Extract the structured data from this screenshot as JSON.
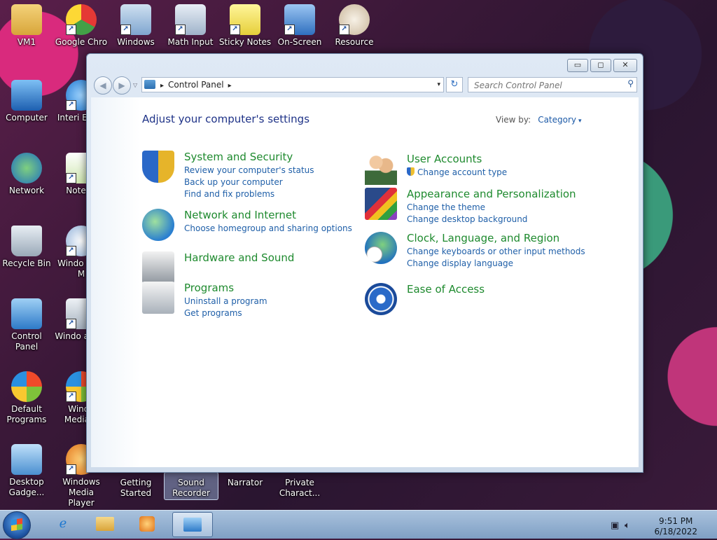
{
  "desktop": {
    "icons": [
      {
        "label": "VM1"
      },
      {
        "label": "Google Chro"
      },
      {
        "label": "Windows"
      },
      {
        "label": "Math Input"
      },
      {
        "label": "Sticky Notes"
      },
      {
        "label": "On-Screen"
      },
      {
        "label": "Resource"
      },
      {
        "label": "Computer"
      },
      {
        "label": "Interi Explo"
      },
      {
        "label": "Network"
      },
      {
        "label": "Notepa"
      },
      {
        "label": "Recycle Bin"
      },
      {
        "label": "Windo DVD M"
      },
      {
        "label": "Control Panel"
      },
      {
        "label": "Windo and S"
      },
      {
        "label": "Default Programs"
      },
      {
        "label": "Windo Media C"
      },
      {
        "label": "Desktop Gadge..."
      },
      {
        "label": "Windows Media Player"
      },
      {
        "label": "Getting Started"
      },
      {
        "label": "Sound Recorder"
      },
      {
        "label": "Narrator"
      },
      {
        "label": "Private Charact..."
      }
    ]
  },
  "window": {
    "caption": {
      "minimize": "▭",
      "maximize": "◻",
      "close": "✕"
    },
    "nav": {
      "back": "◀",
      "forward": "▶",
      "dropdown": "▽"
    },
    "address": {
      "crumb": "Control Panel",
      "crumb_arrow": "▸",
      "dropdown": "▾"
    },
    "refresh": "↻",
    "search": {
      "placeholder": "Search Control Panel",
      "icon": "⚲"
    },
    "page_title": "Adjust your computer's settings",
    "view_by": {
      "label": "View by:",
      "value": "Category",
      "arrow": "▾"
    },
    "categories": [
      {
        "title": "System and Security",
        "links": [
          "Review your computer's status",
          "Back up your computer",
          "Find and fix problems"
        ]
      },
      {
        "title": "Network and Internet",
        "links": [
          "Choose homegroup and sharing options"
        ]
      },
      {
        "title": "Hardware and Sound",
        "links": []
      },
      {
        "title": "Programs",
        "links": [
          "Uninstall a program",
          "Get programs"
        ]
      },
      {
        "title": "User Accounts",
        "links": [
          "Change account type"
        ]
      },
      {
        "title": "Appearance and Personalization",
        "links": [
          "Change the theme",
          "Change desktop background"
        ]
      },
      {
        "title": "Clock, Language, and Region",
        "links": [
          "Change keyboards or other input methods",
          "Change display language"
        ]
      },
      {
        "title": "Ease of Access",
        "links": []
      }
    ]
  },
  "taskbar": {
    "clock": {
      "time": "9:51 PM",
      "date": "6/18/2022"
    }
  },
  "colors": {
    "link": "#1f5fa8",
    "category_title": "#1e8a2e",
    "page_title": "#1e3287"
  }
}
